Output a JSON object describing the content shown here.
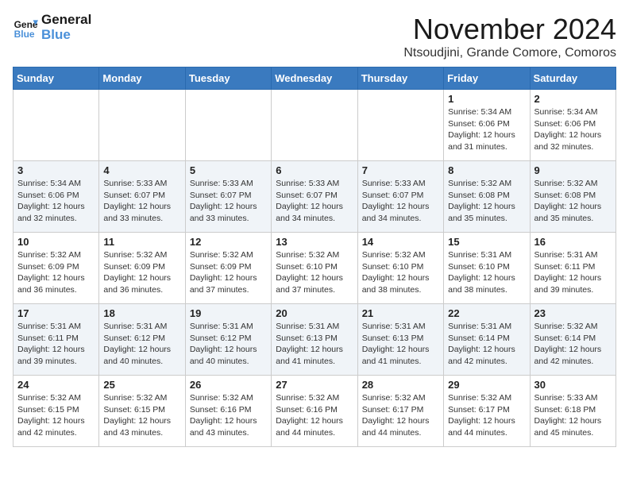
{
  "logo": {
    "line1": "General",
    "line2": "Blue"
  },
  "header": {
    "month": "November 2024",
    "location": "Ntsoudjini, Grande Comore, Comoros"
  },
  "weekdays": [
    "Sunday",
    "Monday",
    "Tuesday",
    "Wednesday",
    "Thursday",
    "Friday",
    "Saturday"
  ],
  "weeks": [
    [
      {
        "day": "",
        "info": ""
      },
      {
        "day": "",
        "info": ""
      },
      {
        "day": "",
        "info": ""
      },
      {
        "day": "",
        "info": ""
      },
      {
        "day": "",
        "info": ""
      },
      {
        "day": "1",
        "info": "Sunrise: 5:34 AM\nSunset: 6:06 PM\nDaylight: 12 hours and 31 minutes."
      },
      {
        "day": "2",
        "info": "Sunrise: 5:34 AM\nSunset: 6:06 PM\nDaylight: 12 hours and 32 minutes."
      }
    ],
    [
      {
        "day": "3",
        "info": "Sunrise: 5:34 AM\nSunset: 6:06 PM\nDaylight: 12 hours and 32 minutes."
      },
      {
        "day": "4",
        "info": "Sunrise: 5:33 AM\nSunset: 6:07 PM\nDaylight: 12 hours and 33 minutes."
      },
      {
        "day": "5",
        "info": "Sunrise: 5:33 AM\nSunset: 6:07 PM\nDaylight: 12 hours and 33 minutes."
      },
      {
        "day": "6",
        "info": "Sunrise: 5:33 AM\nSunset: 6:07 PM\nDaylight: 12 hours and 34 minutes."
      },
      {
        "day": "7",
        "info": "Sunrise: 5:33 AM\nSunset: 6:07 PM\nDaylight: 12 hours and 34 minutes."
      },
      {
        "day": "8",
        "info": "Sunrise: 5:32 AM\nSunset: 6:08 PM\nDaylight: 12 hours and 35 minutes."
      },
      {
        "day": "9",
        "info": "Sunrise: 5:32 AM\nSunset: 6:08 PM\nDaylight: 12 hours and 35 minutes."
      }
    ],
    [
      {
        "day": "10",
        "info": "Sunrise: 5:32 AM\nSunset: 6:09 PM\nDaylight: 12 hours and 36 minutes."
      },
      {
        "day": "11",
        "info": "Sunrise: 5:32 AM\nSunset: 6:09 PM\nDaylight: 12 hours and 36 minutes."
      },
      {
        "day": "12",
        "info": "Sunrise: 5:32 AM\nSunset: 6:09 PM\nDaylight: 12 hours and 37 minutes."
      },
      {
        "day": "13",
        "info": "Sunrise: 5:32 AM\nSunset: 6:10 PM\nDaylight: 12 hours and 37 minutes."
      },
      {
        "day": "14",
        "info": "Sunrise: 5:32 AM\nSunset: 6:10 PM\nDaylight: 12 hours and 38 minutes."
      },
      {
        "day": "15",
        "info": "Sunrise: 5:31 AM\nSunset: 6:10 PM\nDaylight: 12 hours and 38 minutes."
      },
      {
        "day": "16",
        "info": "Sunrise: 5:31 AM\nSunset: 6:11 PM\nDaylight: 12 hours and 39 minutes."
      }
    ],
    [
      {
        "day": "17",
        "info": "Sunrise: 5:31 AM\nSunset: 6:11 PM\nDaylight: 12 hours and 39 minutes."
      },
      {
        "day": "18",
        "info": "Sunrise: 5:31 AM\nSunset: 6:12 PM\nDaylight: 12 hours and 40 minutes."
      },
      {
        "day": "19",
        "info": "Sunrise: 5:31 AM\nSunset: 6:12 PM\nDaylight: 12 hours and 40 minutes."
      },
      {
        "day": "20",
        "info": "Sunrise: 5:31 AM\nSunset: 6:13 PM\nDaylight: 12 hours and 41 minutes."
      },
      {
        "day": "21",
        "info": "Sunrise: 5:31 AM\nSunset: 6:13 PM\nDaylight: 12 hours and 41 minutes."
      },
      {
        "day": "22",
        "info": "Sunrise: 5:31 AM\nSunset: 6:14 PM\nDaylight: 12 hours and 42 minutes."
      },
      {
        "day": "23",
        "info": "Sunrise: 5:32 AM\nSunset: 6:14 PM\nDaylight: 12 hours and 42 minutes."
      }
    ],
    [
      {
        "day": "24",
        "info": "Sunrise: 5:32 AM\nSunset: 6:15 PM\nDaylight: 12 hours and 42 minutes."
      },
      {
        "day": "25",
        "info": "Sunrise: 5:32 AM\nSunset: 6:15 PM\nDaylight: 12 hours and 43 minutes."
      },
      {
        "day": "26",
        "info": "Sunrise: 5:32 AM\nSunset: 6:16 PM\nDaylight: 12 hours and 43 minutes."
      },
      {
        "day": "27",
        "info": "Sunrise: 5:32 AM\nSunset: 6:16 PM\nDaylight: 12 hours and 44 minutes."
      },
      {
        "day": "28",
        "info": "Sunrise: 5:32 AM\nSunset: 6:17 PM\nDaylight: 12 hours and 44 minutes."
      },
      {
        "day": "29",
        "info": "Sunrise: 5:32 AM\nSunset: 6:17 PM\nDaylight: 12 hours and 44 minutes."
      },
      {
        "day": "30",
        "info": "Sunrise: 5:33 AM\nSunset: 6:18 PM\nDaylight: 12 hours and 45 minutes."
      }
    ]
  ]
}
